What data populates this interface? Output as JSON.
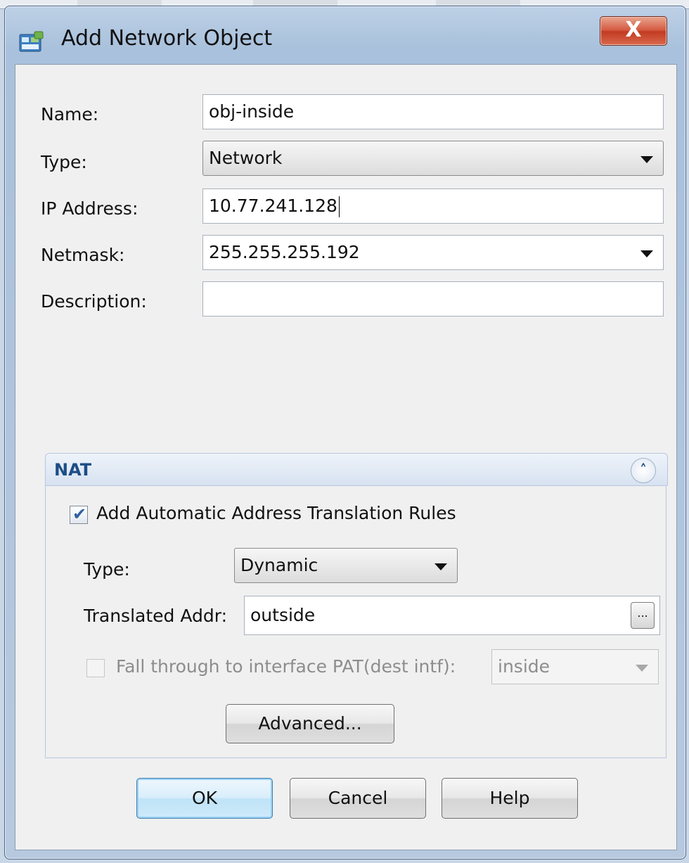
{
  "window": {
    "title": "Add Network Object",
    "close_label": "X",
    "accent": "#1d4d86"
  },
  "form": {
    "name_label": "Name:",
    "name_value": "obj-inside",
    "type_label": "Type:",
    "type_value": "Network",
    "ip_label": "IP Address:",
    "ip_value": "10.77.241.128",
    "netmask_label": "Netmask:",
    "netmask_value": "255.255.255.192",
    "description_label": "Description:",
    "description_value": ""
  },
  "nat": {
    "title": "NAT",
    "collapse_glyph": "˄",
    "auto_rules_label": "Add Automatic Address Translation Rules",
    "auto_rules_checked": true,
    "type_label": "Type:",
    "type_value": "Dynamic",
    "translated_label": "Translated Addr:",
    "translated_value": "outside",
    "browse_label": "...",
    "fallthrough_label": "Fall through to interface PAT(dest intf):",
    "fallthrough_value": "inside",
    "advanced_label": "Advanced..."
  },
  "buttons": {
    "ok": "OK",
    "cancel": "Cancel",
    "help": "Help"
  },
  "icons": [
    "network-object-icon",
    "close-icon",
    "collapse-icon",
    "chevron-down-icon",
    "checkmark-icon",
    "ellipsis-icon"
  ]
}
